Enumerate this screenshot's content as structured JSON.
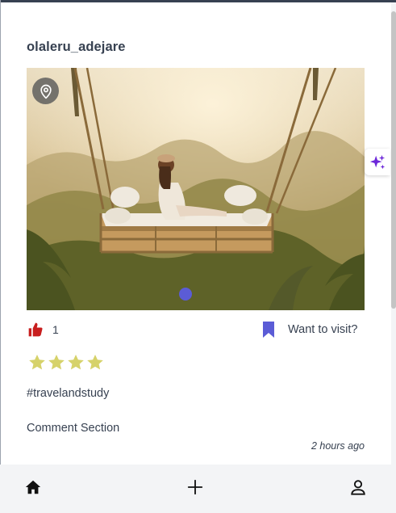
{
  "post": {
    "author": "olaleru_adejare",
    "likes": "1",
    "want_to_visit_label": "Want to visit?",
    "rating": 4,
    "hashtags": "#travelandstudy",
    "comment_section_label": "Comment Section",
    "timestamp": "2 hours ago"
  },
  "colors": {
    "like": "#c81e1e",
    "bookmark": "#5b5cd6",
    "star": "#d6d26a",
    "carousel_dot": "#5b5cd6",
    "sparkle": "#6d28d9",
    "nav_background": "#f3f4f6"
  },
  "icons": {
    "location": "location-pin-icon",
    "like": "thumbs-up-icon",
    "bookmark": "bookmark-icon",
    "star": "star-icon",
    "sparkle": "sparkle-icon",
    "home": "home-icon",
    "add": "plus-icon",
    "profile": "user-icon"
  }
}
